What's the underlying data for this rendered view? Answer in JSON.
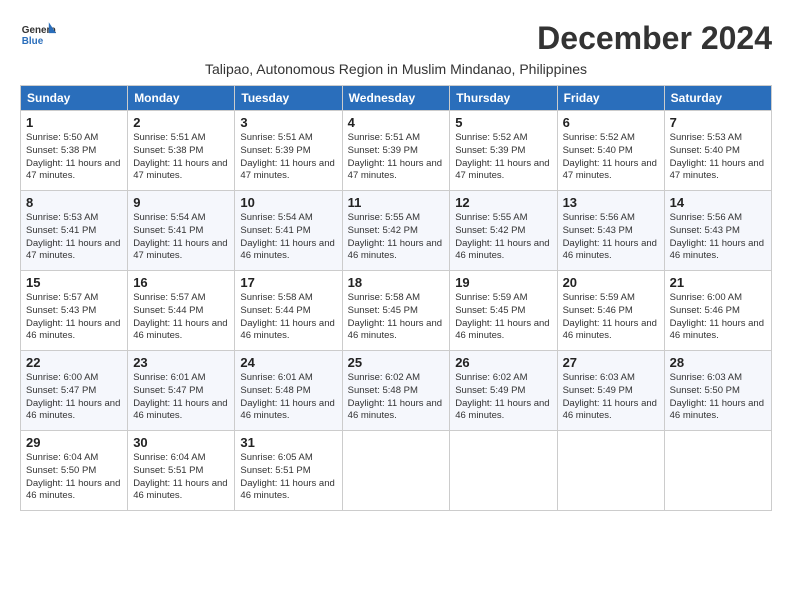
{
  "header": {
    "logo_line1": "General",
    "logo_line2": "Blue",
    "month_year": "December 2024",
    "location": "Talipao, Autonomous Region in Muslim Mindanao, Philippines"
  },
  "days_of_week": [
    "Sunday",
    "Monday",
    "Tuesday",
    "Wednesday",
    "Thursday",
    "Friday",
    "Saturday"
  ],
  "weeks": [
    [
      {
        "day": 1,
        "sunrise": "5:50 AM",
        "sunset": "5:38 PM",
        "daylight": "11 hours and 47 minutes."
      },
      {
        "day": 2,
        "sunrise": "5:51 AM",
        "sunset": "5:38 PM",
        "daylight": "11 hours and 47 minutes."
      },
      {
        "day": 3,
        "sunrise": "5:51 AM",
        "sunset": "5:39 PM",
        "daylight": "11 hours and 47 minutes."
      },
      {
        "day": 4,
        "sunrise": "5:51 AM",
        "sunset": "5:39 PM",
        "daylight": "11 hours and 47 minutes."
      },
      {
        "day": 5,
        "sunrise": "5:52 AM",
        "sunset": "5:39 PM",
        "daylight": "11 hours and 47 minutes."
      },
      {
        "day": 6,
        "sunrise": "5:52 AM",
        "sunset": "5:40 PM",
        "daylight": "11 hours and 47 minutes."
      },
      {
        "day": 7,
        "sunrise": "5:53 AM",
        "sunset": "5:40 PM",
        "daylight": "11 hours and 47 minutes."
      }
    ],
    [
      {
        "day": 8,
        "sunrise": "5:53 AM",
        "sunset": "5:41 PM",
        "daylight": "11 hours and 47 minutes."
      },
      {
        "day": 9,
        "sunrise": "5:54 AM",
        "sunset": "5:41 PM",
        "daylight": "11 hours and 47 minutes."
      },
      {
        "day": 10,
        "sunrise": "5:54 AM",
        "sunset": "5:41 PM",
        "daylight": "11 hours and 46 minutes."
      },
      {
        "day": 11,
        "sunrise": "5:55 AM",
        "sunset": "5:42 PM",
        "daylight": "11 hours and 46 minutes."
      },
      {
        "day": 12,
        "sunrise": "5:55 AM",
        "sunset": "5:42 PM",
        "daylight": "11 hours and 46 minutes."
      },
      {
        "day": 13,
        "sunrise": "5:56 AM",
        "sunset": "5:43 PM",
        "daylight": "11 hours and 46 minutes."
      },
      {
        "day": 14,
        "sunrise": "5:56 AM",
        "sunset": "5:43 PM",
        "daylight": "11 hours and 46 minutes."
      }
    ],
    [
      {
        "day": 15,
        "sunrise": "5:57 AM",
        "sunset": "5:43 PM",
        "daylight": "11 hours and 46 minutes."
      },
      {
        "day": 16,
        "sunrise": "5:57 AM",
        "sunset": "5:44 PM",
        "daylight": "11 hours and 46 minutes."
      },
      {
        "day": 17,
        "sunrise": "5:58 AM",
        "sunset": "5:44 PM",
        "daylight": "11 hours and 46 minutes."
      },
      {
        "day": 18,
        "sunrise": "5:58 AM",
        "sunset": "5:45 PM",
        "daylight": "11 hours and 46 minutes."
      },
      {
        "day": 19,
        "sunrise": "5:59 AM",
        "sunset": "5:45 PM",
        "daylight": "11 hours and 46 minutes."
      },
      {
        "day": 20,
        "sunrise": "5:59 AM",
        "sunset": "5:46 PM",
        "daylight": "11 hours and 46 minutes."
      },
      {
        "day": 21,
        "sunrise": "6:00 AM",
        "sunset": "5:46 PM",
        "daylight": "11 hours and 46 minutes."
      }
    ],
    [
      {
        "day": 22,
        "sunrise": "6:00 AM",
        "sunset": "5:47 PM",
        "daylight": "11 hours and 46 minutes."
      },
      {
        "day": 23,
        "sunrise": "6:01 AM",
        "sunset": "5:47 PM",
        "daylight": "11 hours and 46 minutes."
      },
      {
        "day": 24,
        "sunrise": "6:01 AM",
        "sunset": "5:48 PM",
        "daylight": "11 hours and 46 minutes."
      },
      {
        "day": 25,
        "sunrise": "6:02 AM",
        "sunset": "5:48 PM",
        "daylight": "11 hours and 46 minutes."
      },
      {
        "day": 26,
        "sunrise": "6:02 AM",
        "sunset": "5:49 PM",
        "daylight": "11 hours and 46 minutes."
      },
      {
        "day": 27,
        "sunrise": "6:03 AM",
        "sunset": "5:49 PM",
        "daylight": "11 hours and 46 minutes."
      },
      {
        "day": 28,
        "sunrise": "6:03 AM",
        "sunset": "5:50 PM",
        "daylight": "11 hours and 46 minutes."
      }
    ],
    [
      {
        "day": 29,
        "sunrise": "6:04 AM",
        "sunset": "5:50 PM",
        "daylight": "11 hours and 46 minutes."
      },
      {
        "day": 30,
        "sunrise": "6:04 AM",
        "sunset": "5:51 PM",
        "daylight": "11 hours and 46 minutes."
      },
      {
        "day": 31,
        "sunrise": "6:05 AM",
        "sunset": "5:51 PM",
        "daylight": "11 hours and 46 minutes."
      },
      null,
      null,
      null,
      null
    ]
  ]
}
